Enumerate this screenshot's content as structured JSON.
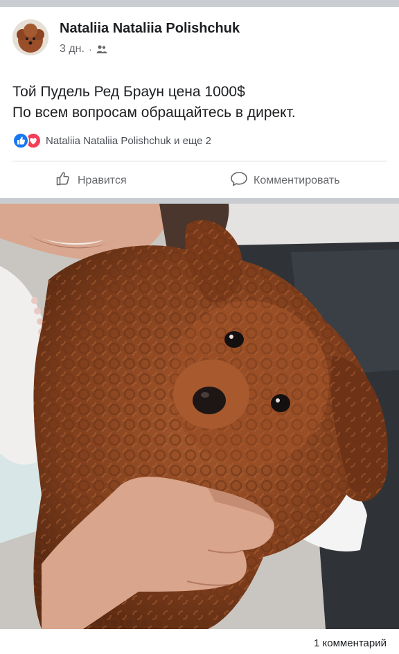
{
  "post": {
    "author": "Nataliia Nataliia Polishchuk",
    "time": "3 дн.",
    "separator": "·",
    "text_lines": [
      "Той Пудель Ред Браун цена 1000$",
      "По всем вопросам обращайтесь в директ."
    ],
    "reactions_text": "Nataliia Nataliia Polishchuk и еще 2",
    "like_label": "Нравится",
    "comment_label": "Комментировать",
    "comment_count": "1 комментарий"
  },
  "icons": {
    "audience": "friends-icon",
    "reaction_1": "like-reaction-icon",
    "reaction_2": "love-reaction-icon",
    "like_button": "thumbs-up-icon",
    "comment_button": "speech-bubble-icon"
  },
  "colors": {
    "like_blue": "#1877f2",
    "love_red": "#f33e58",
    "secondary_text": "#65676b",
    "separator_gray": "#c9ccd1"
  }
}
